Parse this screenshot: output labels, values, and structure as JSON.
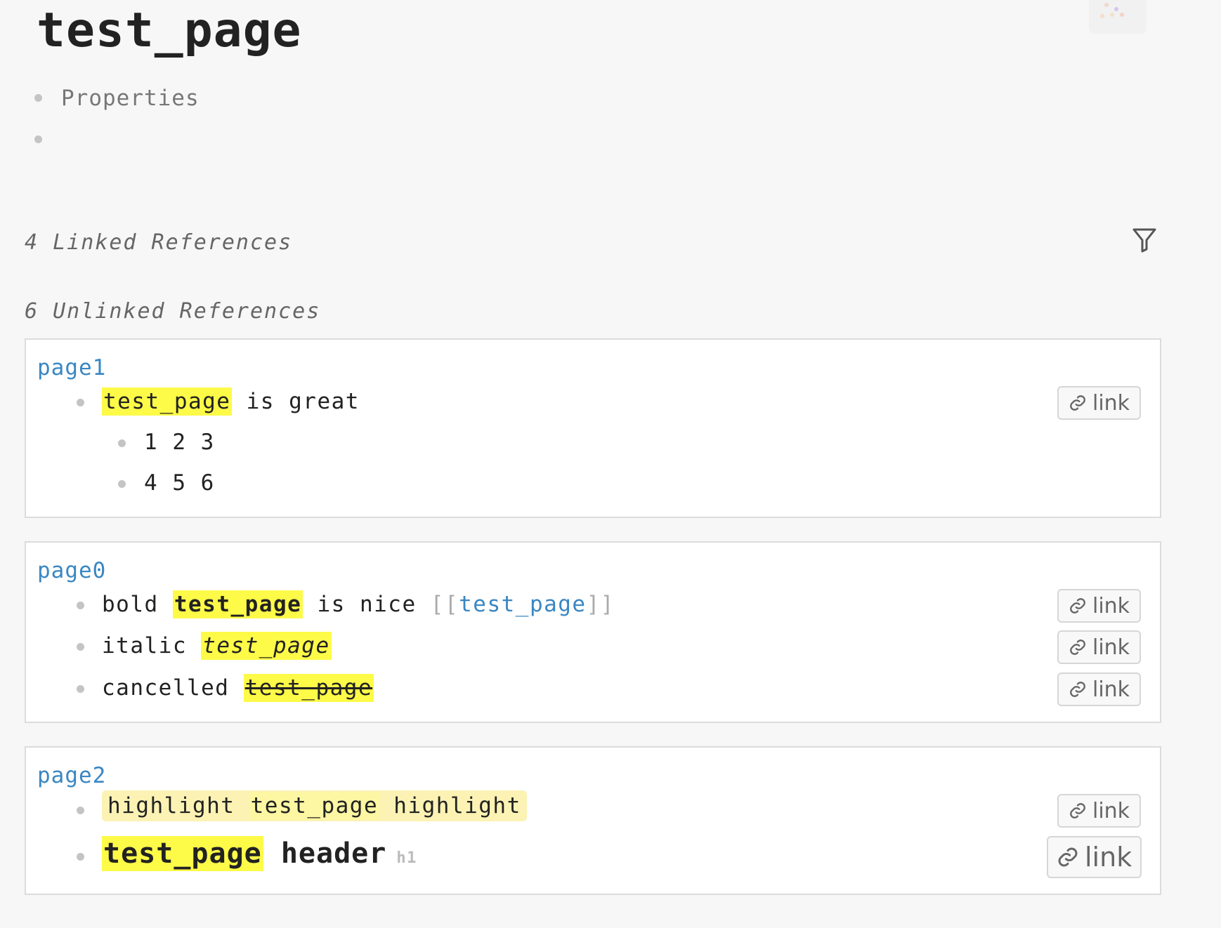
{
  "page": {
    "title": "test_page",
    "properties_label": "Properties"
  },
  "linked": {
    "heading": "4 Linked References"
  },
  "unlinked": {
    "heading": "6 Unlinked References"
  },
  "icons": {
    "filter": "filter-icon",
    "link": "link-icon",
    "bullet": "bullet-icon"
  },
  "cards": [
    {
      "title": "page1",
      "rows": [
        {
          "highlight": "test_page",
          "after": " is great",
          "link": "link"
        },
        {
          "text": "1 2 3"
        },
        {
          "text": "4 5 6"
        }
      ]
    },
    {
      "title": "page0",
      "rows": [
        {
          "before": "bold ",
          "highlight": "test_page",
          "after": " is nice ",
          "bracket_open": "[[",
          "wikilink": "test_page",
          "bracket_close": "]]",
          "link": "link"
        },
        {
          "before": "italic ",
          "highlight": "test_page",
          "link": "link"
        },
        {
          "before": "cancelled ",
          "highlight": "test_page",
          "link": "link"
        }
      ]
    },
    {
      "title": "page2",
      "rows": [
        {
          "before": "highlight ",
          "highlight": "test_page",
          "after": " highlight",
          "link": "link"
        },
        {
          "highlight": "test_page",
          "after": " header",
          "tag": "h1",
          "link": "link"
        }
      ]
    }
  ],
  "colors": {
    "background": "#f7f7f7",
    "link_blue": "#3a87c3",
    "highlight_yellow": "#fdfa48",
    "highlight_block": "#fbf2b4"
  }
}
